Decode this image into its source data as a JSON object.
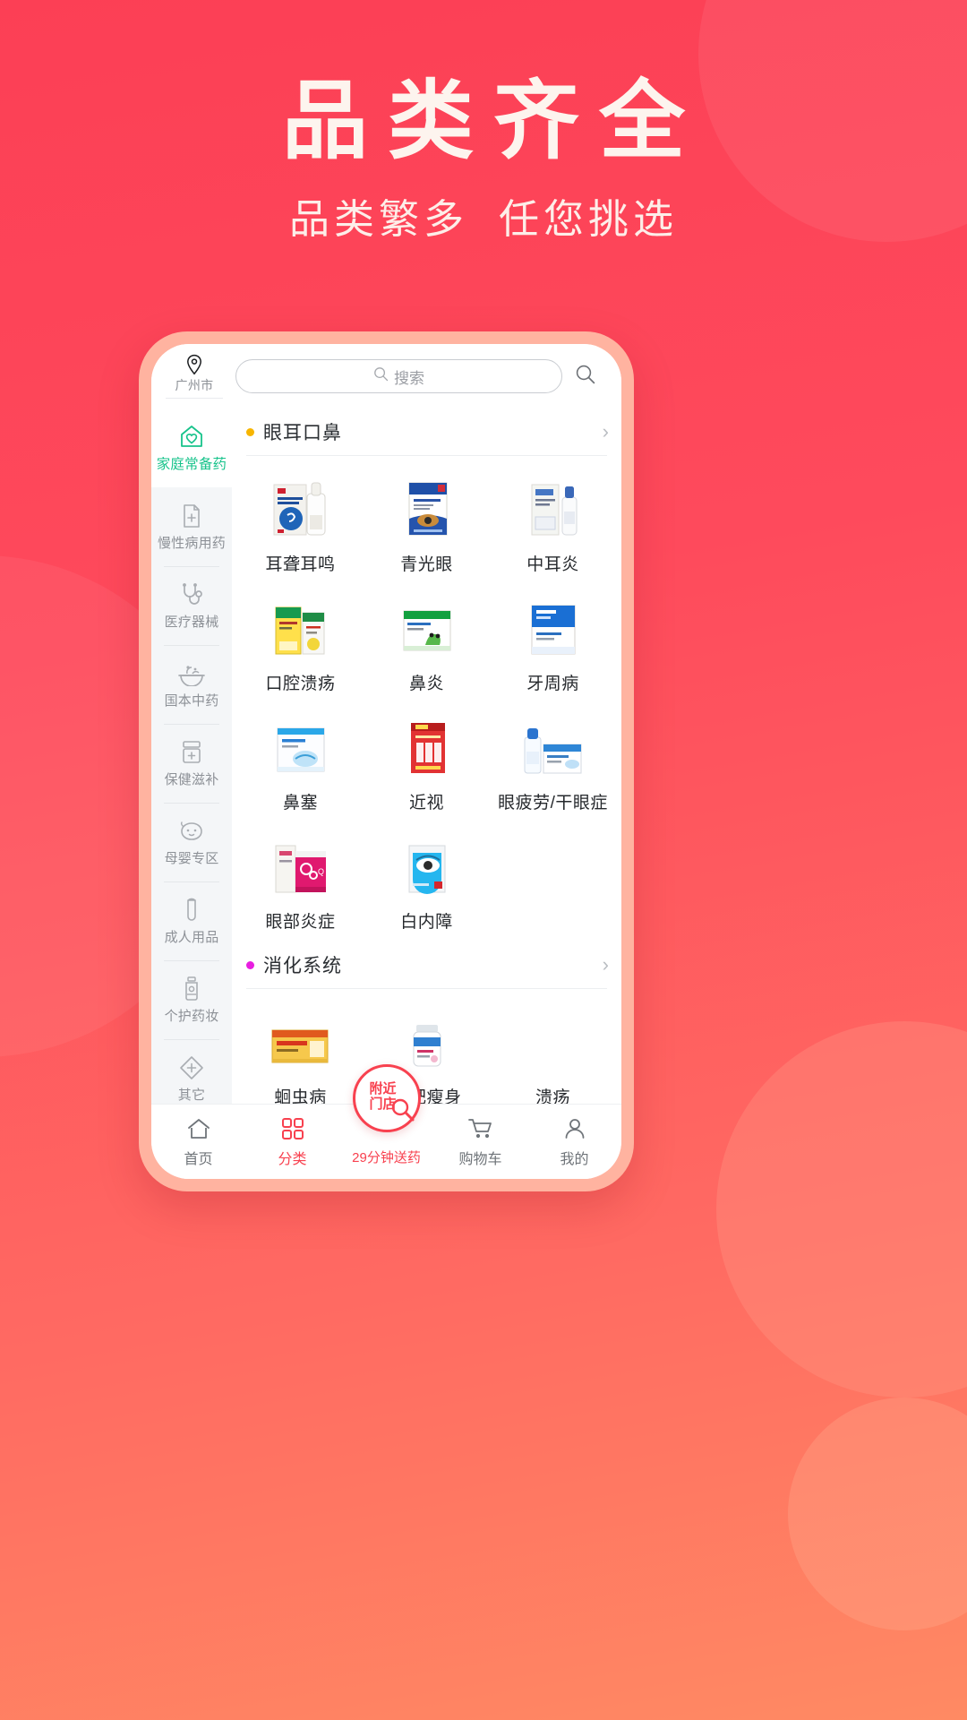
{
  "hero": {
    "title": "品类齐全",
    "subtitle_left": "品类繁多",
    "subtitle_right": "任您挑选"
  },
  "colors": {
    "brand_red": "#f8414f",
    "bg_red": "#ff4a5e",
    "accent_green": "#17c38b",
    "dot_orange": "#f7b500",
    "dot_magenta": "#e81ee0"
  },
  "app": {
    "header": {
      "location_icon": "map-pin-icon",
      "location": "广州市",
      "search_placeholder": "搜索",
      "search_icon": "search-icon",
      "right_search_icon": "search-icon"
    },
    "sidebar": [
      {
        "label": "家庭常备药",
        "icon": "home-heart-icon",
        "active": true
      },
      {
        "label": "慢性病用药",
        "icon": "file-plus-icon",
        "active": false
      },
      {
        "label": "医疗器械",
        "icon": "stethoscope-icon",
        "active": false
      },
      {
        "label": "国本中药",
        "icon": "herbal-bowl-icon",
        "active": false
      },
      {
        "label": "保健滋补",
        "icon": "supplement-box-icon",
        "active": false
      },
      {
        "label": "母婴专区",
        "icon": "baby-face-icon",
        "active": false
      },
      {
        "label": "成人用品",
        "icon": "adult-product-icon",
        "active": false
      },
      {
        "label": "个护药妆",
        "icon": "cosmetic-tube-icon",
        "active": false
      },
      {
        "label": "其它",
        "icon": "diamond-plus-icon",
        "active": false
      }
    ],
    "sections": [
      {
        "title": "眼耳口鼻",
        "dot_color": "#f7b500",
        "chevron": "›",
        "items": [
          {
            "label": "耳聋耳鸣"
          },
          {
            "label": "青光眼"
          },
          {
            "label": "中耳炎"
          },
          {
            "label": "口腔溃疡"
          },
          {
            "label": "鼻炎"
          },
          {
            "label": "牙周病"
          },
          {
            "label": "鼻塞"
          },
          {
            "label": "近视"
          },
          {
            "label": "眼疲劳/干眼症"
          },
          {
            "label": "眼部炎症"
          },
          {
            "label": "白内障"
          }
        ]
      },
      {
        "title": "消化系统",
        "dot_color": "#e81ee0",
        "chevron": "›",
        "items": [
          {
            "label": "蛔虫病"
          },
          {
            "label": "减肥瘦身"
          },
          {
            "label": "溃疡"
          }
        ]
      }
    ],
    "tabbar": [
      {
        "label": "首页",
        "icon": "home-icon",
        "active": false
      },
      {
        "label": "分类",
        "icon": "grid-icon",
        "active": true
      },
      {
        "label": "29分钟送药",
        "icon": "",
        "active": false,
        "promo": true
      },
      {
        "label": "购物车",
        "icon": "cart-icon",
        "active": false
      },
      {
        "label": "我的",
        "icon": "person-icon",
        "active": false
      }
    ],
    "fab": {
      "line1": "附近",
      "line2": "门店",
      "icon": "magnifier-icon"
    }
  }
}
